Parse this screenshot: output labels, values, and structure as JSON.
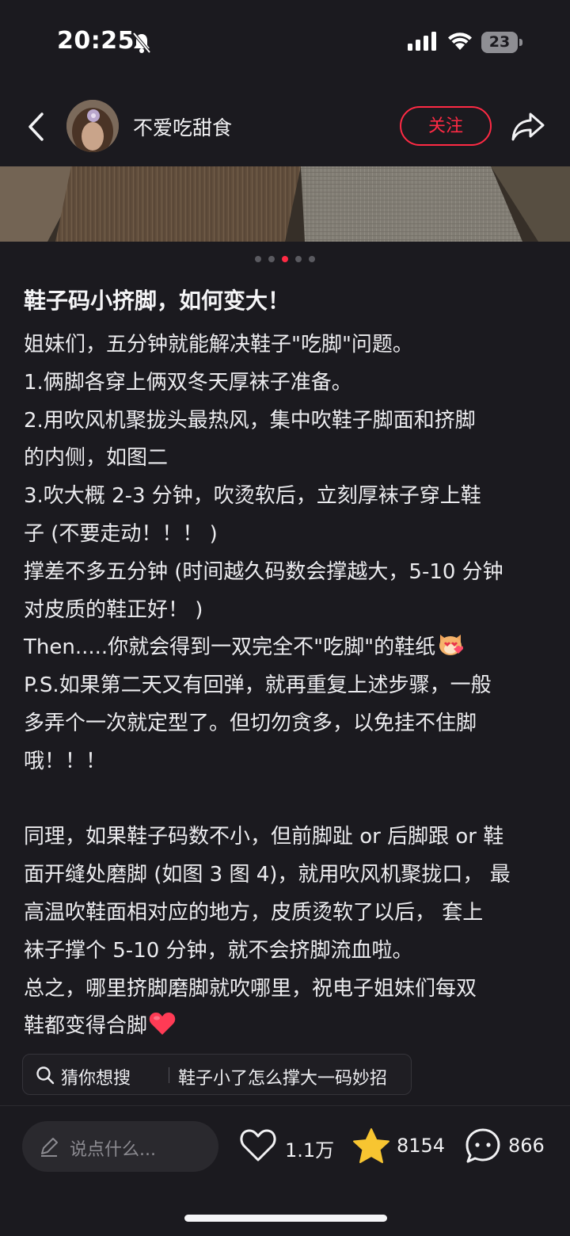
{
  "status_bar": {
    "time": "20:25",
    "battery": "23",
    "icons": [
      "bell-slash-icon",
      "signal-icon",
      "wifi-icon",
      "battery-icon"
    ]
  },
  "header": {
    "author": "不爱吃甜食",
    "follow_label": "关注",
    "icons": [
      "back-icon",
      "avatar",
      "share-icon"
    ]
  },
  "carousel": {
    "total": 5,
    "active_index": 2
  },
  "post": {
    "title": "鞋子码小挤脚，如何变大！",
    "lines": [
      "姐妹们，五分钟就能解决鞋子\"吃脚\"问题。",
      "1.俩脚各穿上俩双冬天厚袜子准备。",
      "2.用吹风机聚拢头最热风，集中吹鞋子脚面和挤脚",
      "的内侧，如图二",
      "3.吹大概 2-3 分钟，吹烫软后，立刻厚袜子穿上鞋",
      "子 (不要走动！！！ )",
      "撑差不多五分钟 (时间越久码数会撑越大，5-10 分钟",
      "对皮质的鞋正好！ )",
      "Then.....你就会得到一双完全不\"吃脚\"的鞋纸",
      "P.S.如果第二天又有回弹，就再重复上述步骤，一般",
      "多弄个一次就定型了。但切勿贪多，以免挂不住脚",
      "哦！！！",
      "",
      "同理，如果鞋子码数不小，但前脚趾 or 后脚跟 or 鞋",
      "面开缝处磨脚 (如图 3 图 4)，就用吹风机聚拢口， 最",
      "高温吹鞋面相对应的地方，皮质烫软了以后， 套上",
      "袜子撑个 5-10 分钟，就不会挤脚流血啦。",
      "总之，哪里挤脚磨脚就吹哪里，祝电子姐妹们每双",
      "鞋都变得合脚"
    ],
    "emojis": [
      "cat-heart-emoji",
      "red-heart-emoji"
    ]
  },
  "search_suggestion": {
    "label": "猜你想搜",
    "query": "鞋子小了怎么撑大一码妙招"
  },
  "bottom_bar": {
    "comment_placeholder": "说点什么...",
    "likes": "1.1万",
    "favorites": "8154",
    "comments": "866",
    "colors": {
      "accent": "#ff2a44",
      "star": "#f7c531"
    }
  }
}
